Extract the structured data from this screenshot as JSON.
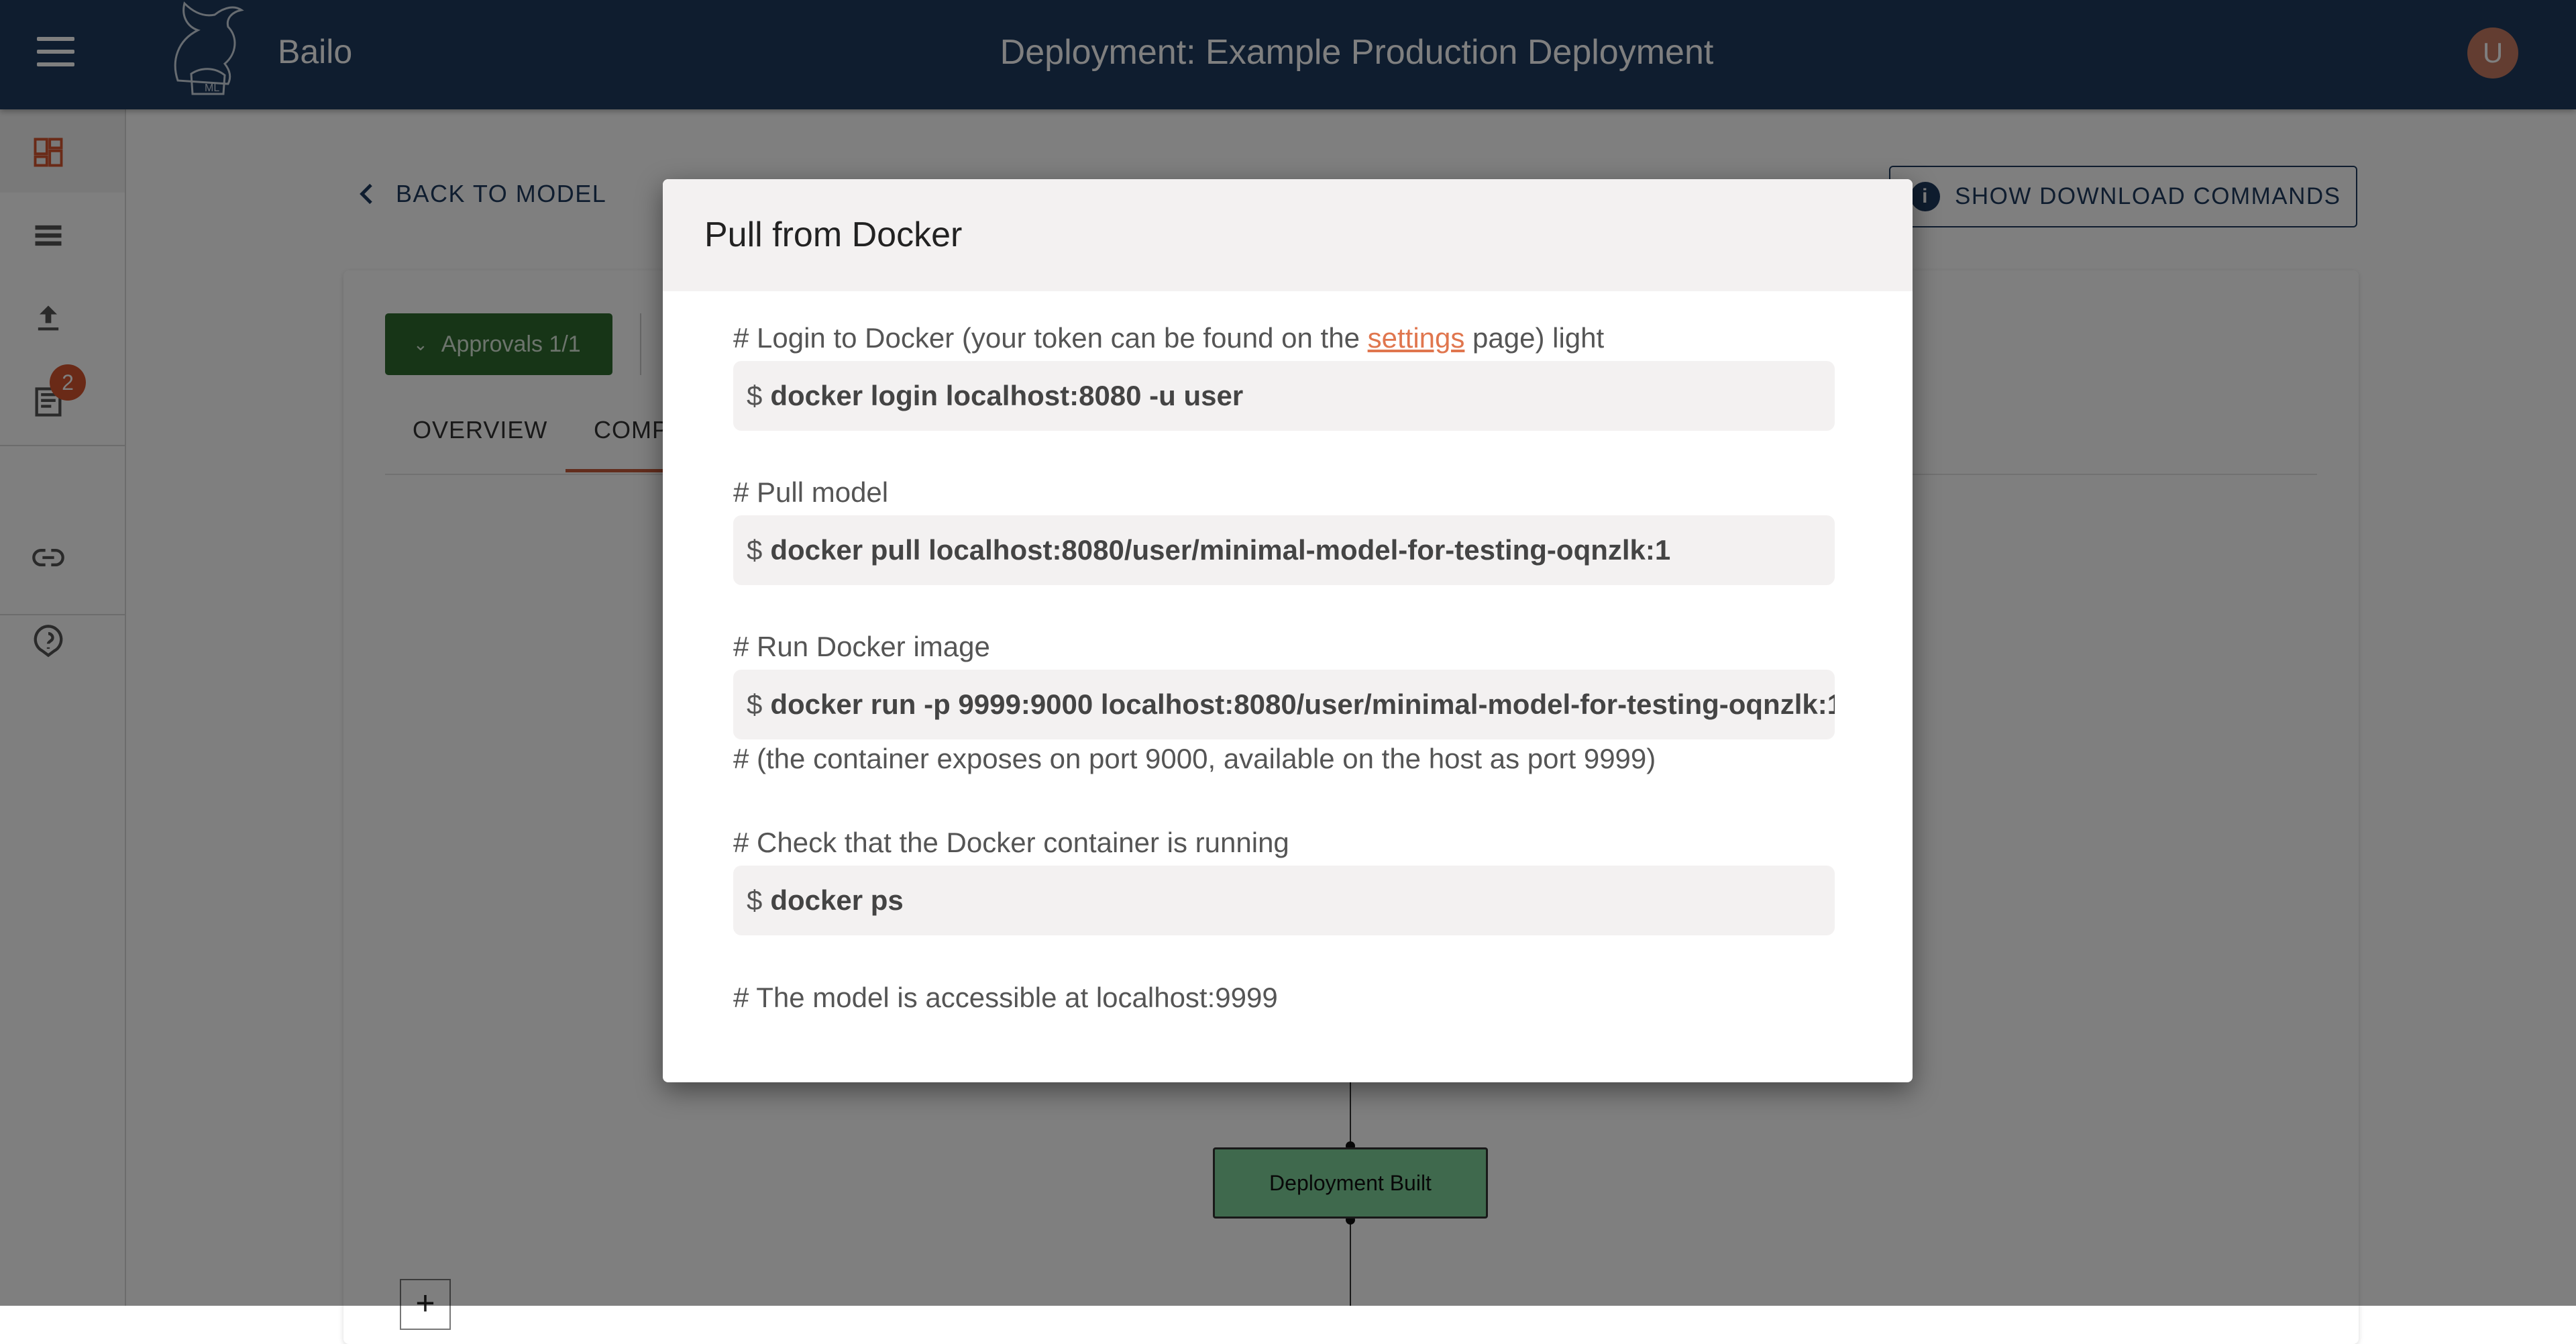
{
  "appbar": {
    "brand": "Bailo",
    "page_title": "Deployment: Example Production Deployment",
    "avatar_initial": "U",
    "logo_text": "ML"
  },
  "sidenav": {
    "badge_count": "2"
  },
  "page": {
    "back_label": "BACK TO MODEL",
    "download_button_label": "SHOW DOWNLOAD COMMANDS",
    "info_glyph": "i",
    "approvals_label": "Approvals 1/1",
    "tabs": [
      {
        "label": "OVERVIEW"
      },
      {
        "label": "COMP"
      }
    ],
    "flow_node_label": "Deployment Built",
    "zoom_in_label": "+"
  },
  "dialog": {
    "title": "Pull from Docker",
    "prompt": "$",
    "login_comment_prefix": "# Login to Docker (your token can be found on the ",
    "login_comment_link": "settings",
    "login_comment_suffix": " page) light",
    "login_cmd": "docker login localhost:8080 -u user",
    "pull_comment": "# Pull model",
    "pull_cmd": "docker pull localhost:8080/user/minimal-model-for-testing-oqnzlk:1",
    "run_comment": "# Run Docker image",
    "run_cmd": "docker run -p 9999:9000 localhost:8080/user/minimal-model-for-testing-oqnzlk:1",
    "run_note": "# (the container exposes on port 9000, available on the host as port 9999)",
    "check_comment": "# Check that the Docker container is running",
    "check_cmd": "docker ps",
    "access_comment": "# The model is accessible at localhost:9999"
  },
  "colors": {
    "appbar": "#1f3a5f",
    "accent": "#c45a3b",
    "link": "#e0764e",
    "approve": "#2e6b2e",
    "node": "#7fd29a"
  }
}
